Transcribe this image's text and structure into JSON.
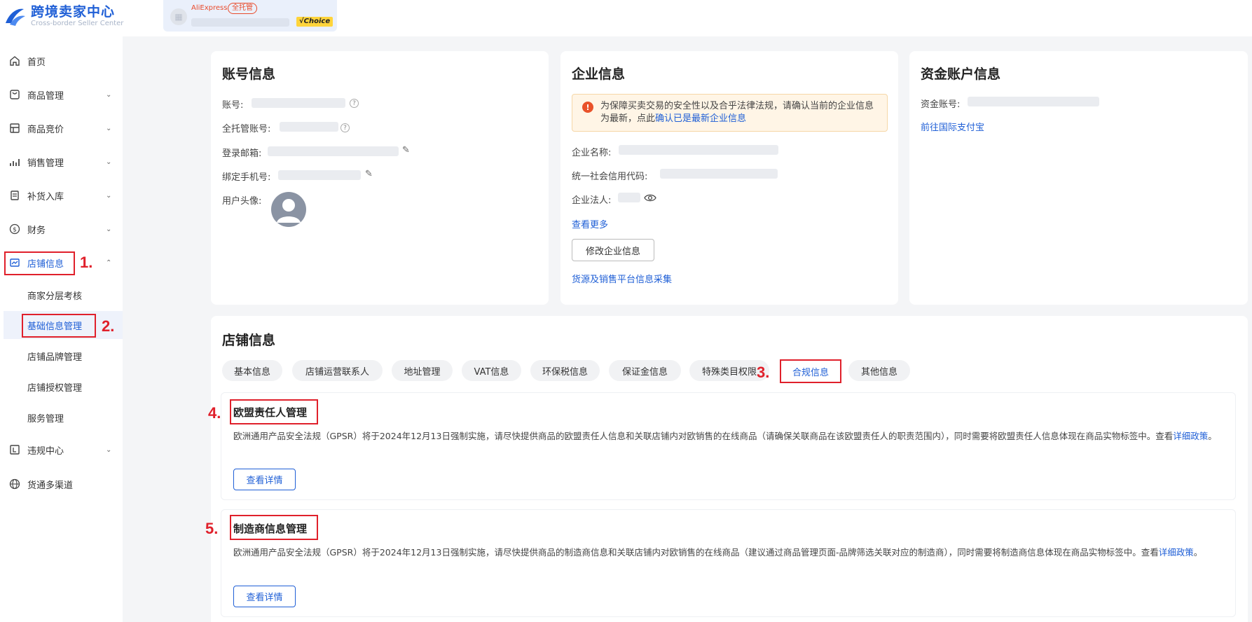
{
  "header": {
    "logo_title": "跨境卖家中心",
    "logo_subtitle": "Cross-border Seller Center",
    "store_brand": "AliExpress",
    "store_tag": "全托管",
    "choice_badge": "√Choice"
  },
  "sidebar": {
    "items": [
      {
        "label": "首页",
        "icon": "home-icon"
      },
      {
        "label": "商品管理",
        "icon": "product-icon"
      },
      {
        "label": "商品竞价",
        "icon": "bidding-icon"
      },
      {
        "label": "销售管理",
        "icon": "sales-chart-icon"
      },
      {
        "label": "补货入库",
        "icon": "clipboard-icon"
      },
      {
        "label": "财务",
        "icon": "dollar-icon"
      },
      {
        "label": "店铺信息",
        "icon": "store-icon"
      },
      {
        "label": "违规中心",
        "icon": "violation-icon"
      },
      {
        "label": "货通多渠道",
        "icon": "globe-icon"
      }
    ],
    "sub_items": [
      {
        "label": "商家分层考核"
      },
      {
        "label": "基础信息管理"
      },
      {
        "label": "店铺品牌管理"
      },
      {
        "label": "店铺授权管理"
      },
      {
        "label": "服务管理"
      }
    ]
  },
  "annotations": {
    "n1": "1.",
    "n2": "2.",
    "n3": "3.",
    "n4": "4.",
    "n5": "5."
  },
  "account_card": {
    "title": "账号信息",
    "account_label": "账号:",
    "full_account_label": "全托管账号:",
    "email_label": "登录邮箱:",
    "phone_label": "绑定手机号:",
    "avatar_label": "用户头像:"
  },
  "company_card": {
    "title": "企业信息",
    "warning_text": "为保障买卖交易的安全性以及合乎法律法规，请确认当前的企业信息为最新，点此",
    "warning_link": "确认已是最新企业信息",
    "name_label": "企业名称:",
    "credit_label": "统一社会信用代码:",
    "legal_label": "企业法人:",
    "more_link": "查看更多",
    "edit_button": "修改企业信息",
    "survey_link": "货源及销售平台信息采集"
  },
  "fund_card": {
    "title": "资金账户信息",
    "account_label": "资金账号:",
    "alipay_link": "前往国际支付宝"
  },
  "store_section": {
    "title": "店铺信息",
    "tabs": [
      "基本信息",
      "店铺运营联系人",
      "地址管理",
      "VAT信息",
      "环保税信息",
      "保证金信息",
      "特殊类目权限",
      "合规信息",
      "其他信息"
    ],
    "eu": {
      "title": "欧盟责任人管理",
      "text": "欧洲通用产品安全法规（GPSR）将于2024年12月13日强制实施，请尽快提供商品的欧盟责任人信息和关联店铺内对欧销售的在线商品（请确保关联商品在该欧盟责任人的职责范围内），同时需要将欧盟责任人信息体现在商品实物标签中。查看",
      "link": "详细政策",
      "suffix": "。",
      "button": "查看详情"
    },
    "maker": {
      "title": "制造商信息管理",
      "text": "欧洲通用产品安全法规（GPSR）将于2024年12月13日强制实施，请尽快提供商品的制造商信息和关联店铺内对欧销售的在线商品（建议通过商品管理页面-品牌筛选关联对应的制造商），同时需要将制造商信息体现在商品实物标签中。查看",
      "link": "详细政策",
      "suffix": "。",
      "button": "查看详情"
    }
  }
}
